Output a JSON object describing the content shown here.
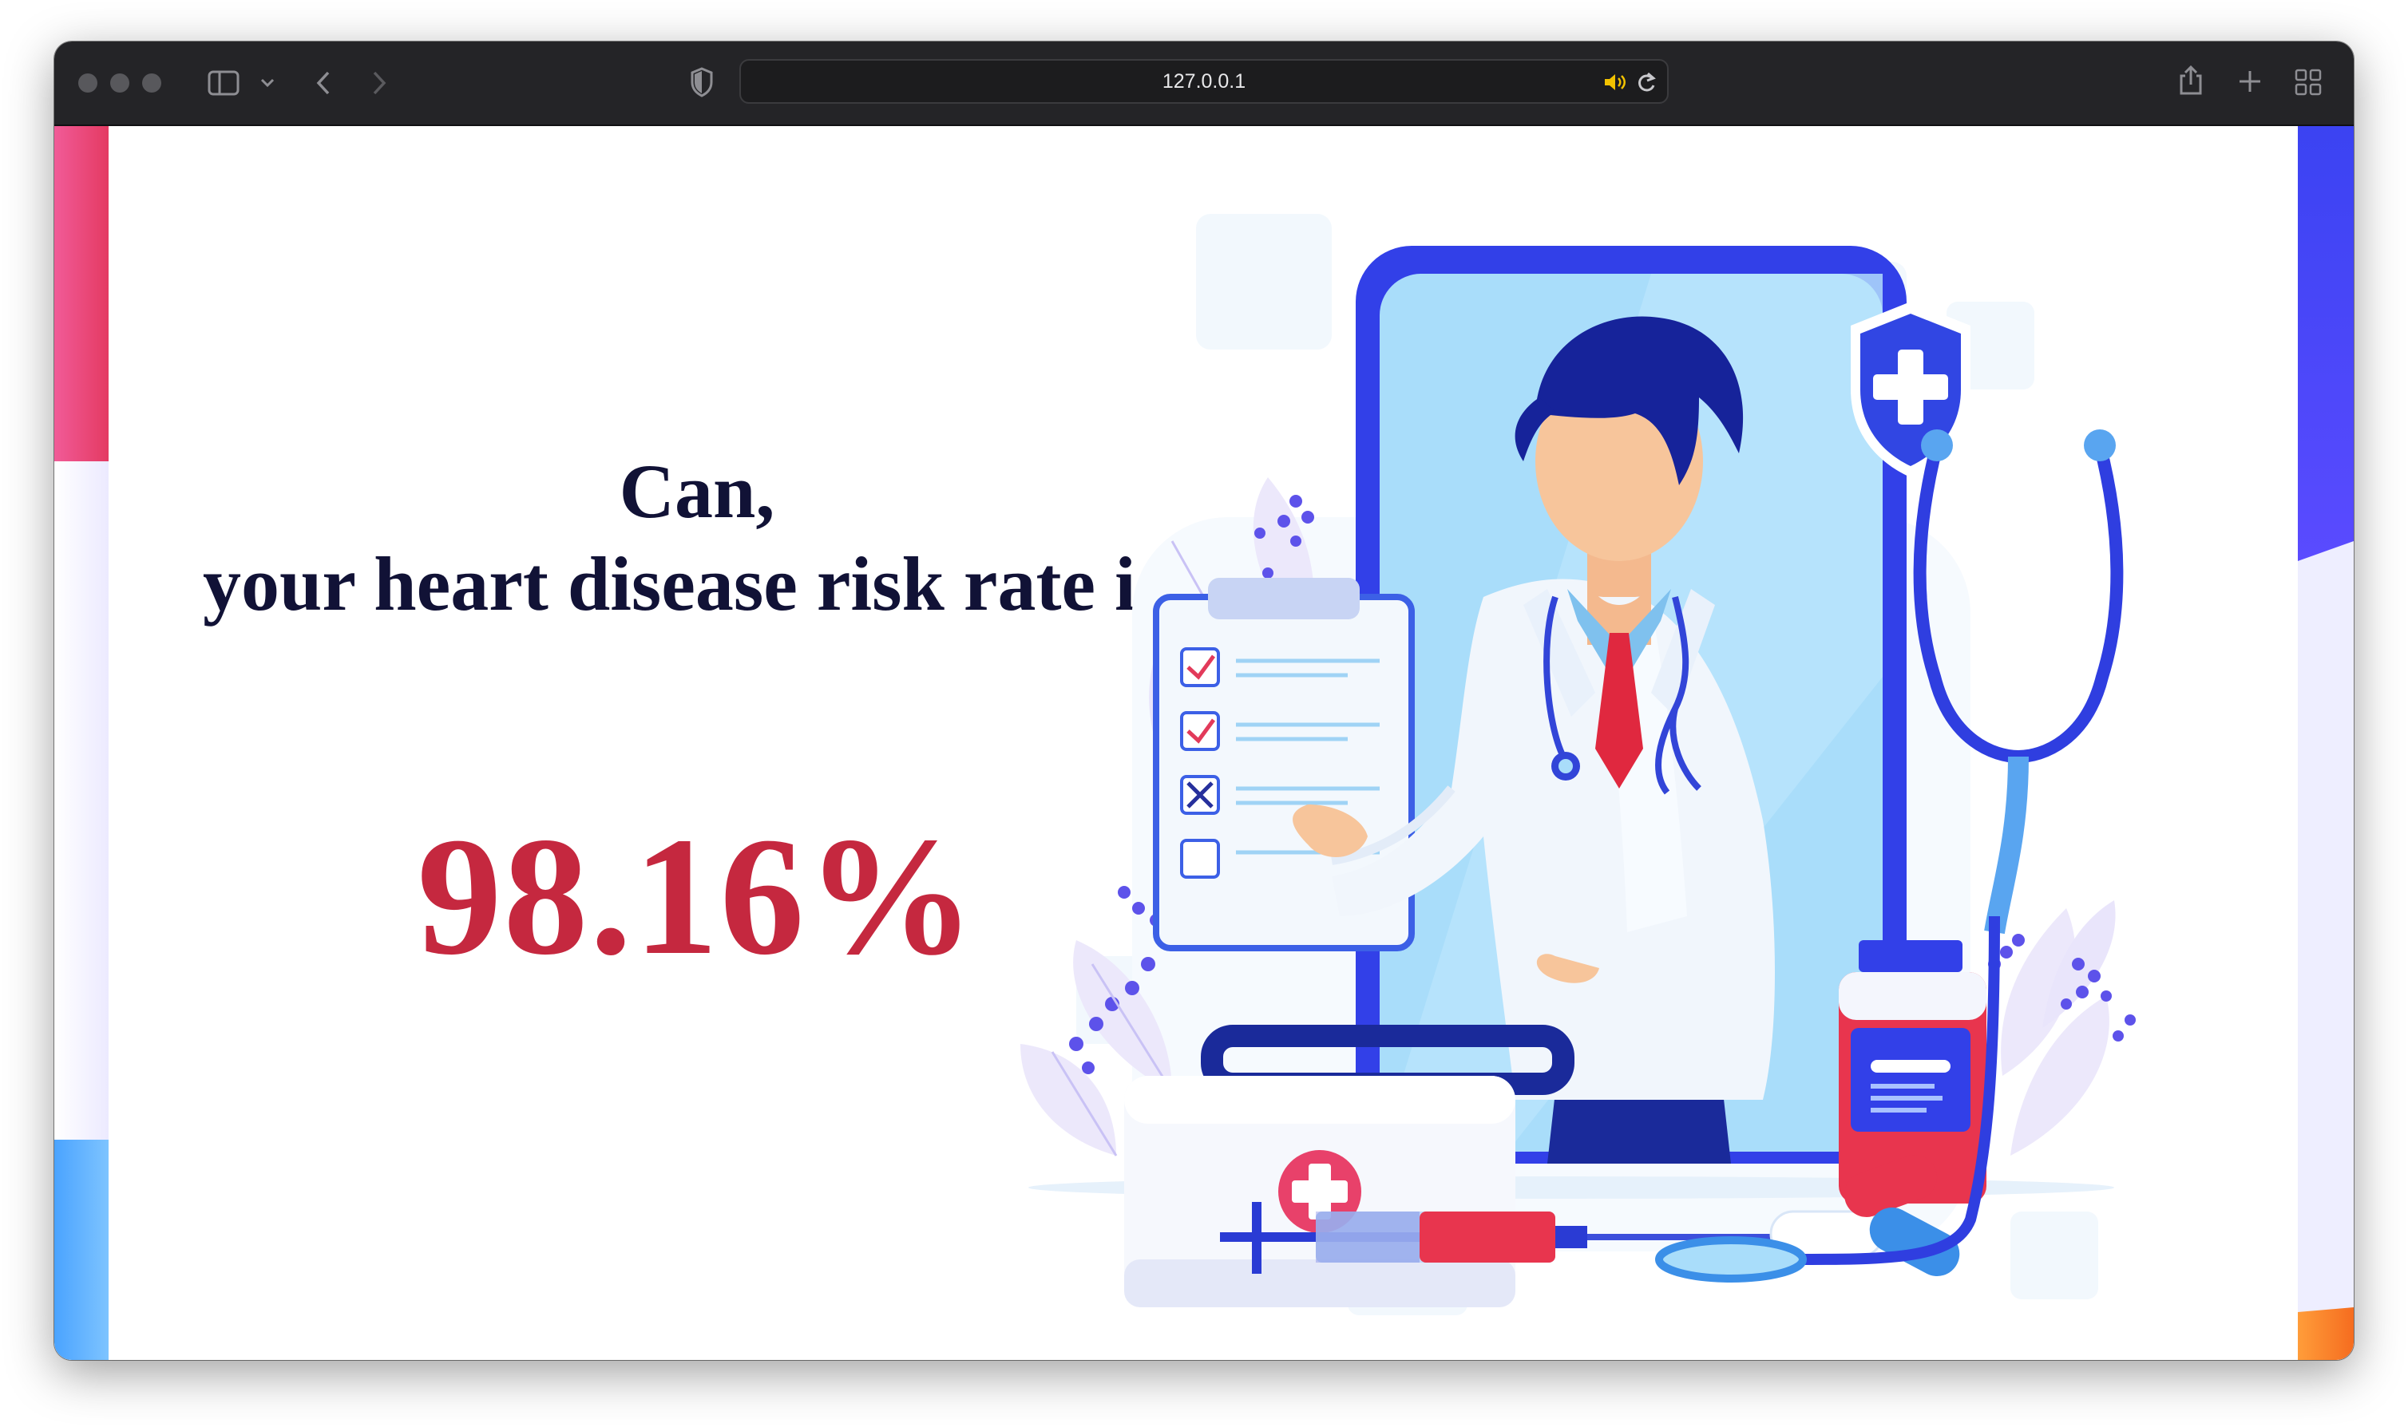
{
  "browser": {
    "url": "127.0.0.1",
    "icons": [
      "sidebar-icon",
      "chevron-down-icon",
      "back-icon",
      "forward-icon",
      "shield-icon",
      "speaker-icon",
      "reload-icon",
      "share-icon",
      "plus-icon",
      "tabs-grid-icon"
    ]
  },
  "page": {
    "heading_line1": "Can,",
    "heading_line2": "your heart disease risk rate is:",
    "risk_rate": "98.16%",
    "accent_color": "#c5283f",
    "heading_color": "#111236"
  }
}
